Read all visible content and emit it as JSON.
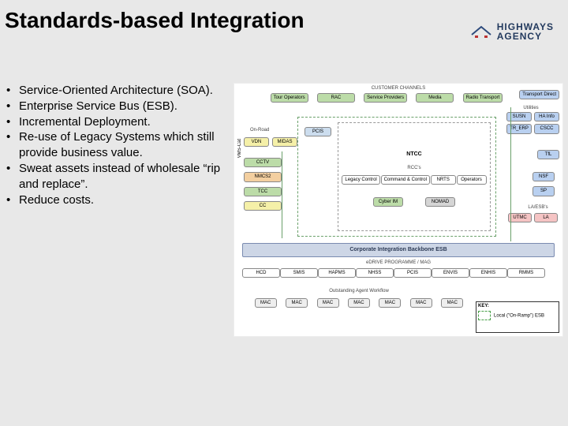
{
  "title": "Standards-based Integration",
  "logo": {
    "line1": "HIGHWAYS",
    "line2": "AGENCY"
  },
  "bullets": [
    "Service-Oriented Architecture (SOA).",
    "Enterprise Service Bus (ESB).",
    "Incremental Deployment.",
    "Re-use of Legacy Systems which still provide business value.",
    "Sweat assets instead of wholesale “rip and replace”.",
    "Reduce costs."
  ],
  "diagram": {
    "header": "CUSTOMER CHANNELS",
    "top_row": [
      "Tour Operators",
      "RAC",
      "Service Providers",
      "Media",
      "Radio Transport"
    ],
    "right_top": [
      "Transport Direct",
      "SUSN",
      "HA Info",
      "TR_ERP",
      "CSCC",
      "TfL"
    ],
    "right_mid_label": "Utilities",
    "right_mid": [
      "NSF",
      "SP"
    ],
    "right_bot_label": "LA/ESB's",
    "right_bot": [
      "UTMC",
      "LA"
    ],
    "left_col_label": "On-Road",
    "left_col": [
      "VDN",
      "MIDAS",
      "CCTV",
      "NMCS2",
      "TCC",
      "CC"
    ],
    "side_label": "VMS-Cat",
    "center_label": "NTCC",
    "rcc_label": "RCC's",
    "rcc_row": [
      "Legacy Control",
      "Command & Control",
      "NRTS",
      "Operators"
    ],
    "sub_row": [
      "Cyber IM",
      "NOMAD"
    ],
    "esb_label": "Corporate Integration Backbone ESB",
    "lower_header": "eDRIVE PROGRAMME / MAG",
    "lower_row": [
      "HCD",
      "SMIS",
      "HAPMS",
      "NHSS",
      "PCIS",
      "ENVIS",
      "ENHIS",
      "RMMS"
    ],
    "lowest_label": "Outstanding Agent Workflow",
    "mac_row": [
      "MAC",
      "MAC",
      "MAC",
      "MAC",
      "MAC",
      "MAC",
      "MAC"
    ],
    "key_title": "KEY:",
    "key_item": "Local (\"On-Ramp\") ESB"
  }
}
